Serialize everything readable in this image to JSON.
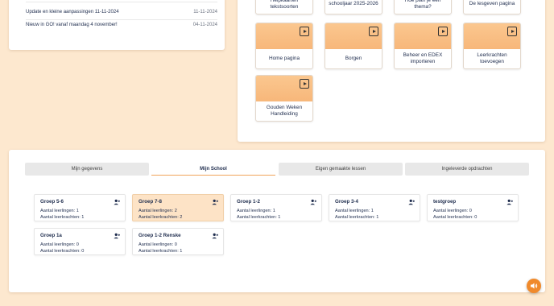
{
  "news": {
    "items": [
      {
        "title": "Update en kleine aanpassingen 11-11-2024",
        "date": "11-11-2024"
      },
      {
        "title": "Nieuw in GO! vanaf maandag 4 november!",
        "date": "04-11-2024"
      }
    ]
  },
  "tiles": {
    "partial": [
      {
        "label": "Helpkaarten tekstsoorten"
      },
      {
        "label": "schooljaar 2025-2026"
      },
      {
        "label": "Hoe plan je een thema?"
      },
      {
        "label": "De lesgeven pagina"
      }
    ],
    "items": [
      {
        "label": "Home pagina"
      },
      {
        "label": "Borgen"
      },
      {
        "label": "Beheer en EDEX importeren"
      },
      {
        "label": "Leerkrachten toevoegen"
      },
      {
        "label": "Gouden Weken Handleiding"
      }
    ]
  },
  "tabs": [
    {
      "label": "Mijn gegevens"
    },
    {
      "label": "Mijn School"
    },
    {
      "label": "Eigen gemaakte lessen"
    },
    {
      "label": "Ingeleverde opdrachten"
    }
  ],
  "groups": [
    {
      "name": "Groep 5-6",
      "students": "Aantal leerlingen: 1",
      "teachers": "Aantal leerkrachten: 1"
    },
    {
      "name": "Groep 7-8",
      "students": "Aantal leerlingen: 2",
      "teachers": "Aantal leerkrachten: 2"
    },
    {
      "name": "Groep 1-2",
      "students": "Aantal leerlingen: 1",
      "teachers": "Aantal leerkrachten: 1"
    },
    {
      "name": "Groep 3-4",
      "students": "Aantal leerlingen: 1",
      "teachers": "Aantal leerkrachten: 1"
    },
    {
      "name": "testgroep",
      "students": "Aantal leerlingen: 0",
      "teachers": "Aantal leerkrachten: 0"
    },
    {
      "name": "Groep 1a",
      "students": "Aantal leerlingen: 0",
      "teachers": "Aantal leerkrachten: 0"
    },
    {
      "name": "Groep 1-2 Renske",
      "students": "Aantal leerlingen: 0",
      "teachers": "Aantal leerkrachten: 1"
    }
  ],
  "colors": {
    "accent": "#f08a2c",
    "tile": "#f9bf85",
    "selected_group": "#fde3c6"
  },
  "icons": {
    "tile_play": "play-square-icon",
    "group_user": "user-add-icon",
    "fab": "volume-icon"
  }
}
